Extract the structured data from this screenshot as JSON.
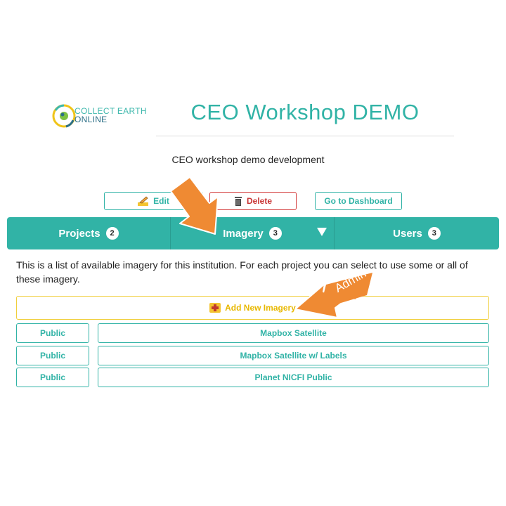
{
  "logo": {
    "line1": "COLLECT EARTH",
    "line2": "ONLINE"
  },
  "institution": {
    "title": "CEO Workshop DEMO",
    "description": "CEO workshop demo development"
  },
  "actions": {
    "edit_label": "Edit",
    "delete_label": "Delete",
    "dashboard_label": "Go to Dashboard"
  },
  "tabs": [
    {
      "label": "Projects",
      "count": "2"
    },
    {
      "label": "Imagery",
      "count": "3"
    },
    {
      "label": "Users",
      "count": "3"
    }
  ],
  "imagery": {
    "info": "This is a list of available imagery for this institution. For each project you can select to use some or all of these imagery.",
    "add_label": "Add New Imagery",
    "items": [
      {
        "visibility": "Public",
        "name": "Mapbox Satellite"
      },
      {
        "visibility": "Public",
        "name": "Mapbox Satellite w/ Labels"
      },
      {
        "visibility": "Public",
        "name": "Planet NICFI Public"
      }
    ]
  },
  "annotation": {
    "admin_label": "Admin"
  },
  "colors": {
    "teal": "#31b3a6",
    "red": "#d33a3a",
    "yellow": "#f0cf3c",
    "arrow": "#ef8a33"
  }
}
